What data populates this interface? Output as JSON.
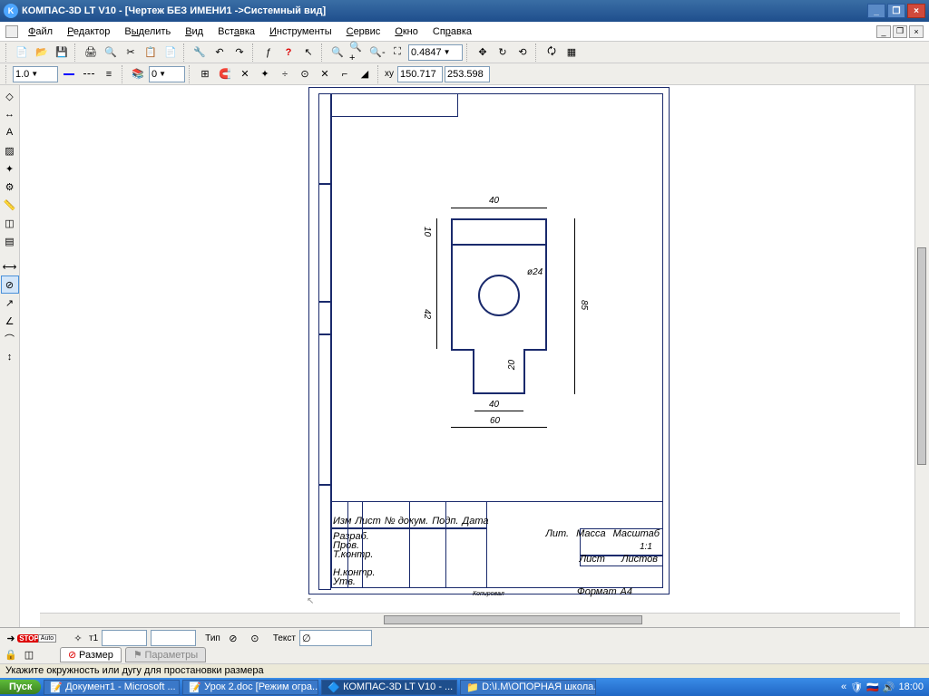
{
  "title": "КОМПАС-3D LT V10 - [Чертеж БЕЗ ИМЕНИ1 ->Системный вид]",
  "menu": {
    "file": "Файл",
    "edit": "Редактор",
    "select": "Выделить",
    "view": "Вид",
    "insert": "Вставка",
    "tools": "Инструменты",
    "service": "Сервис",
    "window": "Окно",
    "help": "Справка"
  },
  "tb2": {
    "zoom": "0.4847"
  },
  "tb3": {
    "scale": "1.0",
    "layer": "0",
    "x": "150.717",
    "y": "253.598"
  },
  "sheet": {
    "dims": {
      "w_top": "40",
      "h_left": "10",
      "dia": "ø24",
      "h_mid": "42",
      "cut_h": "20",
      "cut_w": "40",
      "base_w": "60",
      "h_right": "85"
    },
    "title_block": {
      "izm": "Изм",
      "list": "Лист",
      "ndok": "№ докум.",
      "podp": "Подп.",
      "data": "Дата",
      "razrab": "Разраб.",
      "prov": "Пров.",
      "tkontr": "Т.контр.",
      "nkontr": "Н.контр.",
      "utb": "Утв.",
      "lit": "Лит.",
      "massa": "Масса",
      "masshtab": "Масштаб",
      "mvalue": "1:1",
      "list2": "Лист",
      "listov": "Листов",
      "kopiroval": "Копировал",
      "format": "Формат",
      "a4": "А4"
    }
  },
  "bp": {
    "t1": "т1",
    "tip": "Тип",
    "text": "Текст",
    "tab1": "Размер",
    "tab2": "Параметры"
  },
  "status": "Укажите окружность или дугу для простановки размера",
  "taskbar": {
    "start": "Пуск",
    "t1": "Документ1 - Microsoft ...",
    "t2": "Урок 2.doc [Режим огра...",
    "t3": "КОМПАС-3D LT V10 - ...",
    "t4": "D:\\I.М\\ОПОРНАЯ школа...",
    "time": "18:00"
  }
}
